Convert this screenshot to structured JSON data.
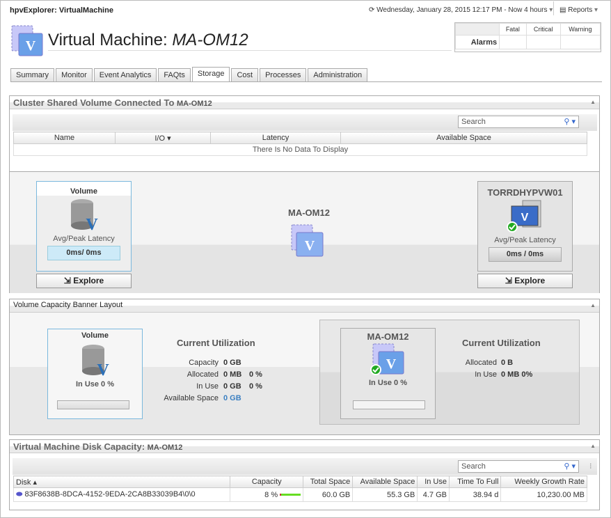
{
  "app_title": "hpvExplorer: VirtualMachine",
  "time_range": "Wednesday, January 28, 2015 12:17 PM - Now 4 hours",
  "reports": "Reports",
  "page_title_prefix": "Virtual Machine: ",
  "page_title_name": "MA-OM12",
  "alarms": {
    "label": "Alarms",
    "columns": [
      "Fatal",
      "Critical",
      "Warning"
    ]
  },
  "tabs": [
    "Summary",
    "Monitor",
    "Event Analytics",
    "FAQts",
    "Storage",
    "Cost",
    "Processes",
    "Administration"
  ],
  "active_tab": "Storage",
  "csv_panel": {
    "title": "Cluster Shared Volume Connected To",
    "title_name": "MA-OM12",
    "search_placeholder": "Search",
    "columns": [
      "Name",
      "I/O",
      "Latency",
      "Available Space"
    ],
    "empty": "There Is No Data To Display"
  },
  "topology": {
    "volume_title": "Volume",
    "latency_label": "Avg/Peak Latency",
    "volume_latency": "0ms/ 0ms",
    "explore": "Explore",
    "center_name": "MA-OM12",
    "host_name": "TORRDHYPVW01",
    "host_latency": "0ms / 0ms"
  },
  "banner": {
    "title": "Volume Capacity Banner Layout",
    "volume_title": "Volume",
    "in_use": "In Use 0 %",
    "current_util": "Current Utilization",
    "rows": [
      {
        "label": "Capacity",
        "value": "0 GB",
        "pct": ""
      },
      {
        "label": "Allocated",
        "value": "0 MB",
        "pct": "0 %"
      },
      {
        "label": "In Use",
        "value": "0 GB",
        "pct": "0 %"
      },
      {
        "label": "Available Space",
        "value": "0 GB",
        "pct": ""
      }
    ],
    "vm_title": "MA-OM12",
    "vm_in_use": "In Use 0 %",
    "vm_rows": [
      {
        "label": "Allocated",
        "value": "0 B"
      },
      {
        "label": "In Use",
        "value": "0 MB 0%"
      }
    ]
  },
  "disk_panel": {
    "title": "Virtual Machine Disk Capacity:",
    "title_name": "MA-OM12",
    "search_placeholder": "Search",
    "columns": [
      "Disk",
      "Capacity",
      "Total Space",
      "Available Space",
      "In Use",
      "Time To Full",
      "Weekly Growth Rate"
    ],
    "rows": [
      {
        "disk": "83F8638B-8DCA-4152-9EDA-2CA8B33039B4\\0\\0",
        "capacity": "8 %",
        "capacity_pct": 8,
        "total": "60.0 GB",
        "available": "55.3 GB",
        "in_use": "4.7 GB",
        "ttf": "38.94 d",
        "growth": "10,230.00 MB"
      }
    ]
  },
  "colors": {
    "accent": "#3a7fc1",
    "volume_border": "#7ab8dd",
    "capacity_bar": "#66dd22"
  }
}
